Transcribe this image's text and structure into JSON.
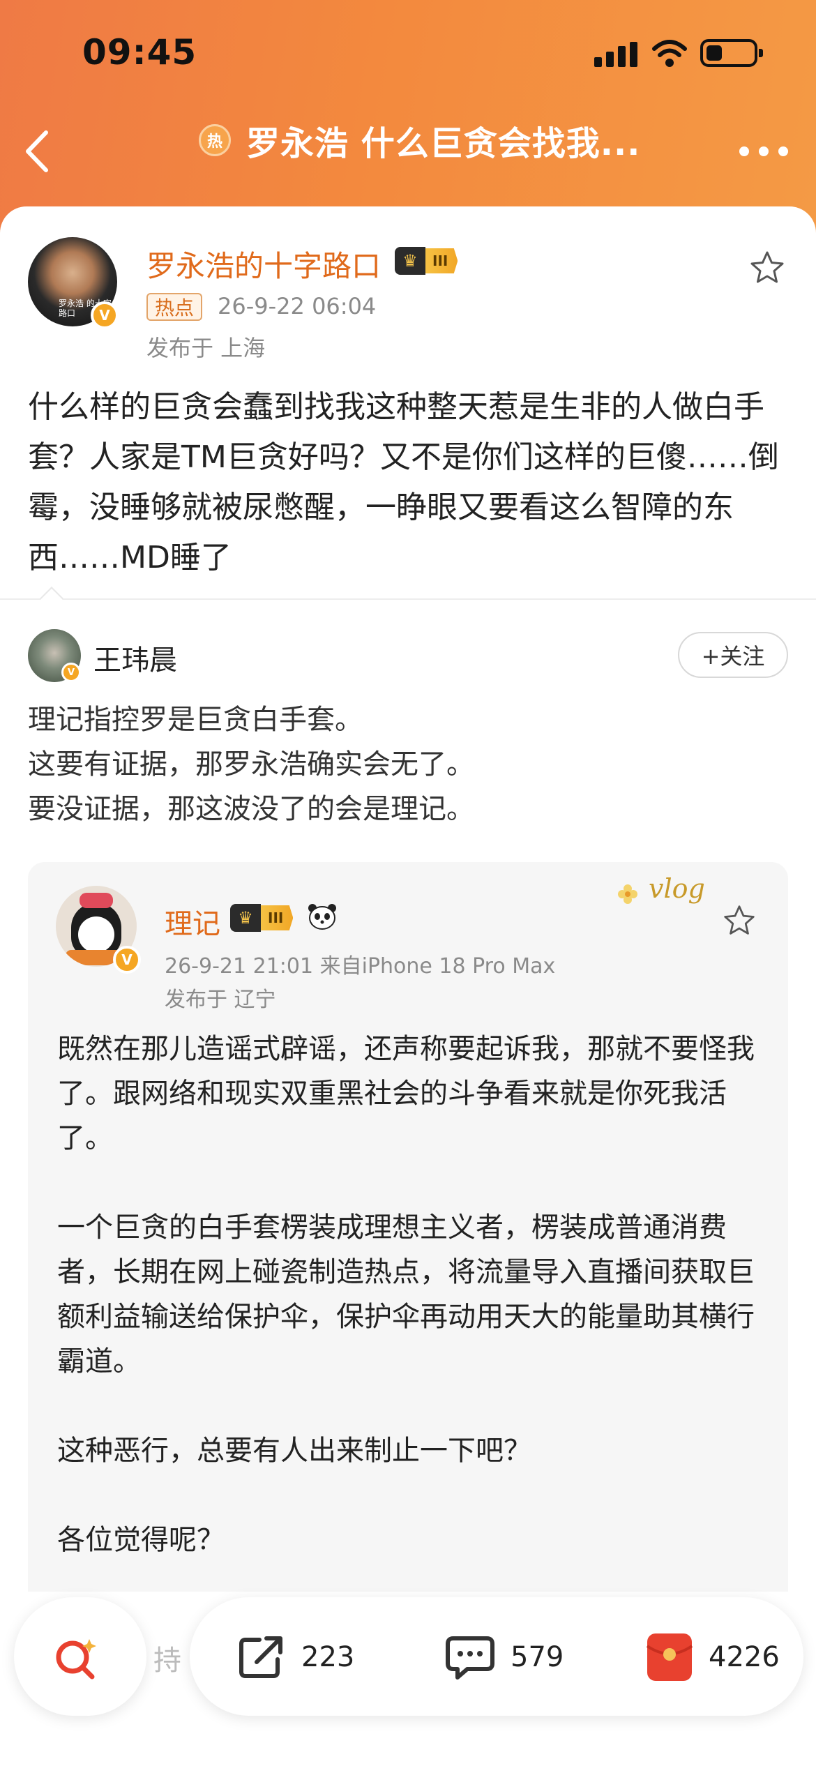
{
  "status_bar": {
    "time": "09:45"
  },
  "nav": {
    "hot_icon": "热",
    "title": "罗永浩 什么巨贪会找我..."
  },
  "post": {
    "author": "罗永浩的十字路口",
    "avatar_caption": "罗永浩 的十字路口",
    "level": "III",
    "tag": "热点",
    "time": "26-9-22 06:04",
    "location": "发布于 上海",
    "body": "什么样的巨贪会蠢到找我这种整天惹是生非的人做白手套？人家是TM巨贪好吗？又不是你们这样的巨傻……倒霉，没睡够就被尿憋醒，一睁眼又要看这么智障的东西……MD睡了"
  },
  "comment": {
    "author": "王玮晨",
    "follow_label": "+关注",
    "lines": [
      "理记指控罗是巨贪白手套。",
      "这要有证据，那罗永浩确实会无了。",
      "要没证据，那这波没了的会是理记。"
    ]
  },
  "quoted": {
    "author": "理记",
    "level": "III",
    "badge": "vlog",
    "time": "26-9-21 21:01  来自iPhone 18 Pro Max",
    "location": "发布于 辽宁",
    "paragraphs": [
      "既然在那儿造谣式辟谣，还声称要起诉我，那就不要怪我了。跟网络和现实双重黑社会的斗争看来就是你死我活了。",
      "一个巨贪的白手套楞装成理想主义者，楞装成普通消费者，长期在网上碰瓷制造热点，将流量导入直播间获取巨额利益输送给保护伞，保护伞再动用天大的能量助其横行霸道。",
      "这种恶行，总要有人出来制止一下吧？",
      "各位觉得呢？"
    ]
  },
  "bottom_bar": {
    "hint": "持",
    "share_count": "223",
    "comment_count": "579",
    "like_count": "4226"
  },
  "colors": {
    "header_orange": "#f3893e",
    "accent": "#e06a1b",
    "red_packet": "#e8412f"
  }
}
